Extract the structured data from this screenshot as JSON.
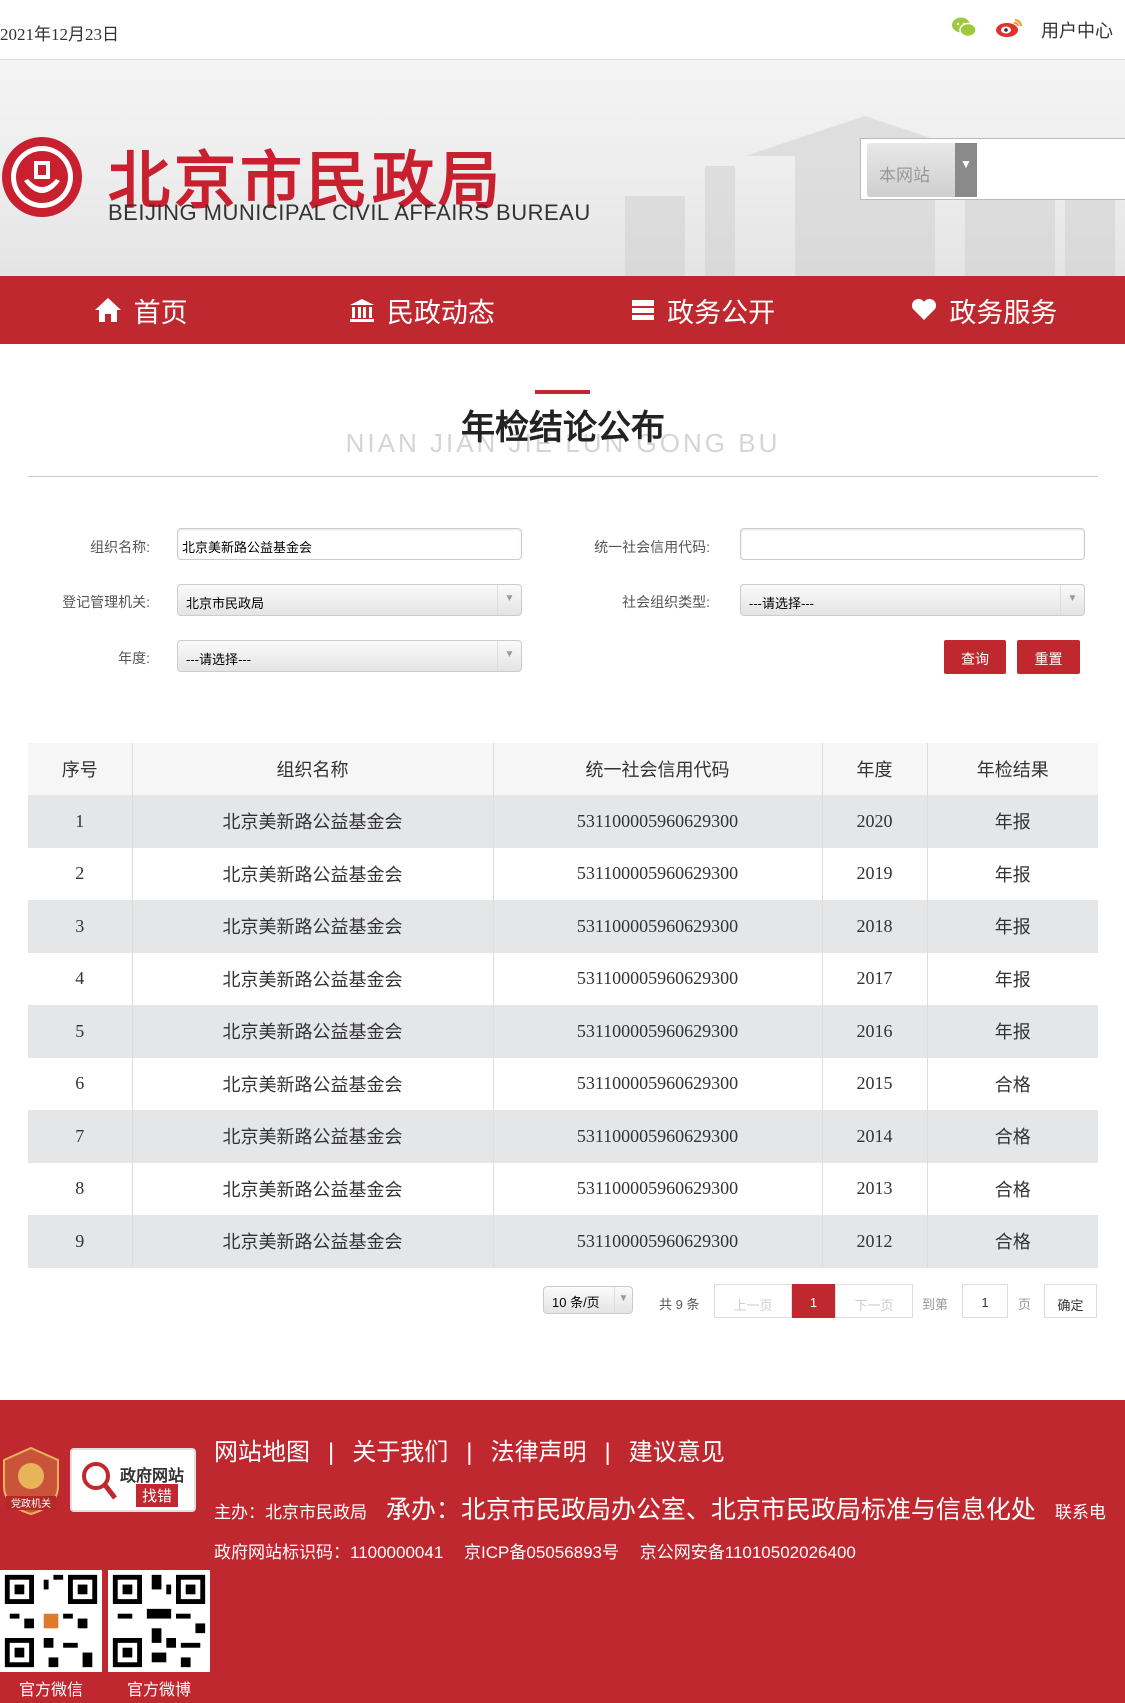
{
  "topbar": {
    "date": "2021年12月23日",
    "user_center": "用户中心",
    "icons": [
      "wechat-icon",
      "weibo-icon"
    ]
  },
  "header": {
    "logo_cn": "北京市民政局",
    "logo_en": "BEIJING MUNICIPAL CIVIL AFFAIRS BUREAU",
    "search_scope": "本网站"
  },
  "nav": {
    "items": [
      {
        "label": "首页",
        "icon": "home-icon"
      },
      {
        "label": "民政动态",
        "icon": "building-icon"
      },
      {
        "label": "政务公开",
        "icon": "stack-icon"
      },
      {
        "label": "政务服务",
        "icon": "heart-icon"
      }
    ]
  },
  "page": {
    "title_cn": "年检结论公布",
    "title_en": "NIAN JIAN JIE LUN GONG BU"
  },
  "form": {
    "org_name_label": "组织名称:",
    "org_name_value": "北京美新路公益基金会",
    "credit_code_label": "统一社会信用代码:",
    "credit_code_value": "",
    "authority_label": "登记管理机关:",
    "authority_value": "北京市民政局",
    "org_type_label": "社会组织类型:",
    "org_type_value": "---请选择---",
    "year_label": "年度:",
    "year_value": "---请选择---",
    "query_button": "查询",
    "reset_button": "重置"
  },
  "table": {
    "headers": [
      "序号",
      "组织名称",
      "统一社会信用代码",
      "年度",
      "年检结果"
    ],
    "rows": [
      [
        "1",
        "北京美新路公益基金会",
        "531100005960629300",
        "2020",
        "年报"
      ],
      [
        "2",
        "北京美新路公益基金会",
        "531100005960629300",
        "2019",
        "年报"
      ],
      [
        "3",
        "北京美新路公益基金会",
        "531100005960629300",
        "2018",
        "年报"
      ],
      [
        "4",
        "北京美新路公益基金会",
        "531100005960629300",
        "2017",
        "年报"
      ],
      [
        "5",
        "北京美新路公益基金会",
        "531100005960629300",
        "2016",
        "年报"
      ],
      [
        "6",
        "北京美新路公益基金会",
        "531100005960629300",
        "2015",
        "合格"
      ],
      [
        "7",
        "北京美新路公益基金会",
        "531100005960629300",
        "2014",
        "合格"
      ],
      [
        "8",
        "北京美新路公益基金会",
        "531100005960629300",
        "2013",
        "合格"
      ],
      [
        "9",
        "北京美新路公益基金会",
        "531100005960629300",
        "2012",
        "合格"
      ]
    ]
  },
  "pagination": {
    "page_size": "10 条/页",
    "total": "共 9 条",
    "prev": "上一页",
    "current": "1",
    "next": "下一页",
    "goto_label": "到第",
    "goto_value": "1",
    "page_unit": "页",
    "confirm": "确定"
  },
  "footer": {
    "links": [
      "网站地图",
      "关于我们",
      "法律声明",
      "建议意见"
    ],
    "separator": "|",
    "host_label": "主办：北京市民政局",
    "undertake": "承办：北京市民政局办公室、北京市民政局标准与信息化处",
    "contact": "联系电",
    "site_id": "政府网站标识码：1100000041",
    "icp": "京ICP备05056893号",
    "police": "京公网安备11010502026400",
    "badge_party": "党政机关",
    "badge_error_title": "政府网站",
    "badge_error_sub": "找错",
    "qr_wechat": "官方微信",
    "qr_weibo": "官方微博"
  },
  "colors": {
    "brand_red": "#c0282f",
    "row_stripe": "#e5e6e8"
  }
}
